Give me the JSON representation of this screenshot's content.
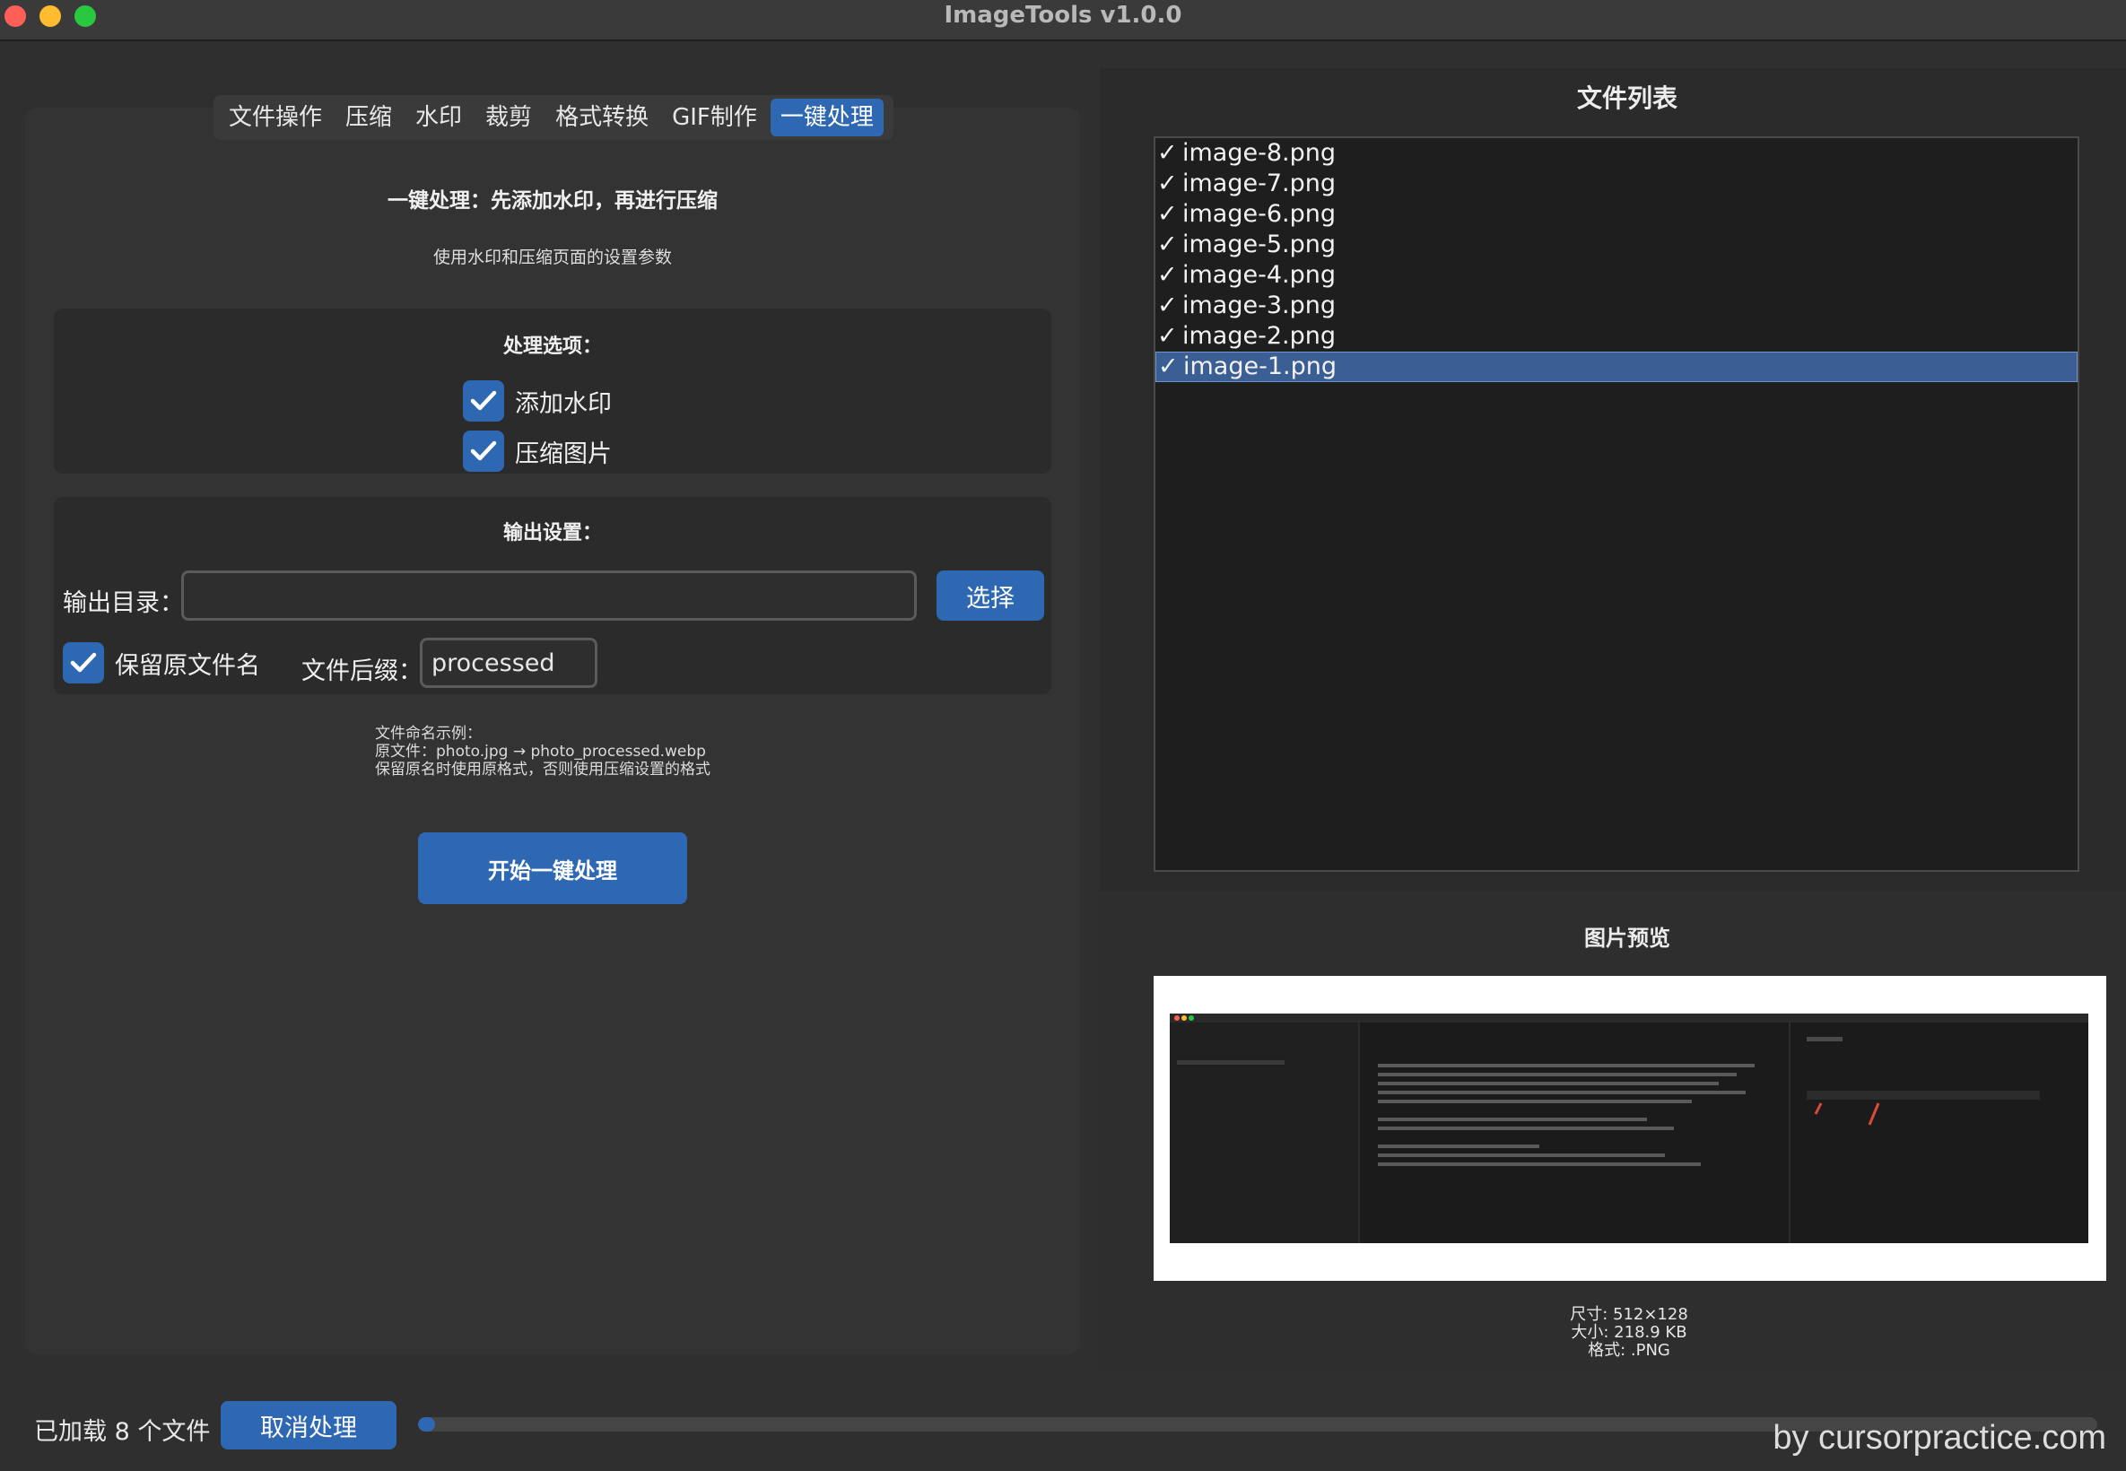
{
  "window": {
    "title": "ImageTools v1.0.0"
  },
  "tabs": [
    {
      "label": "文件操作"
    },
    {
      "label": "压缩"
    },
    {
      "label": "水印"
    },
    {
      "label": "裁剪"
    },
    {
      "label": "格式转换"
    },
    {
      "label": "GIF制作"
    },
    {
      "label": "一键处理",
      "active": true
    }
  ],
  "main": {
    "heading": "一键处理：先添加水印，再进行压缩",
    "subtext": "使用水印和压缩页面的设置参数",
    "options_title": "处理选项：",
    "option_watermark": {
      "label": "添加水印",
      "checked": true
    },
    "option_compress": {
      "label": "压缩图片",
      "checked": true
    },
    "output_title": "输出设置：",
    "output_dir_label": "输出目录：",
    "output_dir_value": "",
    "choose_button": "选择",
    "keep_name": {
      "label": "保留原文件名",
      "checked": true
    },
    "suffix_label": "文件后缀：",
    "suffix_value": "processed",
    "example": {
      "line1": "文件命名示例：",
      "line2": "原文件：photo.jpg → photo_processed.webp",
      "line3": "保留原名时使用原格式，否则使用压缩设置的格式"
    },
    "start_button": "开始一键处理"
  },
  "file_panel": {
    "title": "文件列表",
    "check_mark": "✓",
    "files": [
      {
        "name": "image-8.png",
        "selected": false
      },
      {
        "name": "image-7.png",
        "selected": false
      },
      {
        "name": "image-6.png",
        "selected": false
      },
      {
        "name": "image-5.png",
        "selected": false
      },
      {
        "name": "image-4.png",
        "selected": false
      },
      {
        "name": "image-3.png",
        "selected": false
      },
      {
        "name": "image-2.png",
        "selected": false
      },
      {
        "name": "image-1.png",
        "selected": true
      }
    ]
  },
  "preview": {
    "title": "图片预览",
    "size": "尺寸: 512×128",
    "filesize": "大小: 218.9 KB",
    "format": "格式: .PNG"
  },
  "status": {
    "loaded_text": "已加载 8 个文件",
    "cancel_button": "取消处理",
    "progress_fraction": 0.01
  },
  "watermark_text": "by cursorpractice.com",
  "colors": {
    "accent": "#2f68b2",
    "selection": "#3b5e95"
  }
}
